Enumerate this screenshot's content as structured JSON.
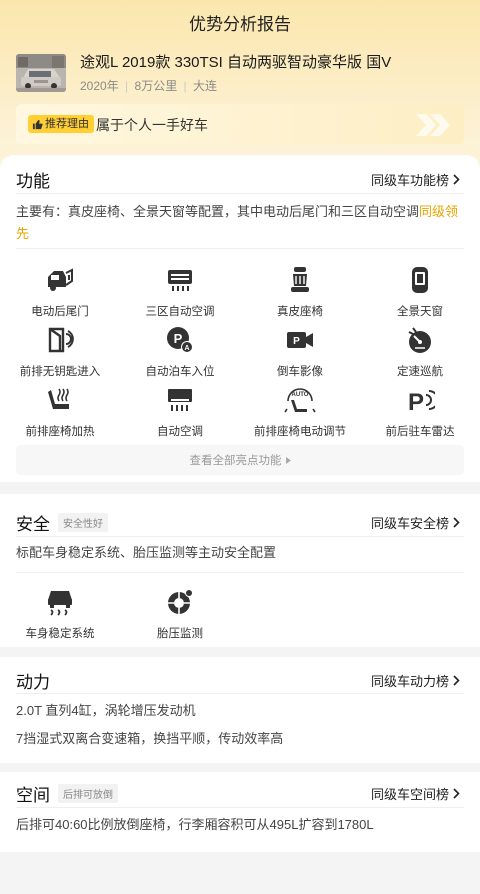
{
  "page": {
    "title": "优势分析报告"
  },
  "car": {
    "name": "途观L 2019款 330TSI 自动两驱智动豪华版 国V",
    "year": "2020年",
    "mileage": "8万公里",
    "city": "大连",
    "sep": "|"
  },
  "reason": {
    "tag": "推荐理由",
    "text": "属于个人一手好车"
  },
  "function": {
    "title": "功能",
    "rank_label": "同级车功能榜",
    "desc_prefix": "主要有：真皮座椅、全景天窗等配置，其中电动后尾门和三区自动空调",
    "desc_highlight": "同级领先",
    "features": [
      {
        "label": "电动后尾门",
        "icon": "tailgate-icon"
      },
      {
        "label": "三区自动空调",
        "icon": "climate-icon"
      },
      {
        "label": "真皮座椅",
        "icon": "leather-seat-icon"
      },
      {
        "label": "全景天窗",
        "icon": "sunroof-icon"
      },
      {
        "label": "前排无钥匙进入",
        "icon": "keyless-entry-icon"
      },
      {
        "label": "自动泊车入位",
        "icon": "auto-parking-icon"
      },
      {
        "label": "倒车影像",
        "icon": "reverse-camera-icon"
      },
      {
        "label": "定速巡航",
        "icon": "cruise-control-icon"
      },
      {
        "label": "前排座椅加热",
        "icon": "seat-heating-icon"
      },
      {
        "label": "自动空调",
        "icon": "auto-ac-icon"
      },
      {
        "label": "前排座椅电动调节",
        "icon": "power-seat-icon"
      },
      {
        "label": "前后驻车雷达",
        "icon": "parking-radar-icon"
      }
    ],
    "more_label": "查看全部亮点功能"
  },
  "safety": {
    "title": "安全",
    "tag": "安全性好",
    "rank_label": "同级车安全榜",
    "desc": "标配车身稳定系统、胎压监测等主动安全配置",
    "features": [
      {
        "label": "车身稳定系统",
        "icon": "stability-control-icon"
      },
      {
        "label": "胎压监测",
        "icon": "tire-pressure-icon"
      }
    ]
  },
  "power": {
    "title": "动力",
    "rank_label": "同级车动力榜",
    "line1": "2.0T 直列4缸，涡轮增压发动机",
    "line2": "7挡湿式双离合变速箱，换挡平顺，传动效率高"
  },
  "space": {
    "title": "空间",
    "tag": "后排可放倒",
    "rank_label": "同级车空间榜",
    "desc": "后排可40:60比例放倒座椅，行李厢容积可从495L扩容到1780L"
  },
  "colors": {
    "accent": "#e8a400",
    "tag_bg": "#ffcf33",
    "header_bg": "#fbe6ad"
  }
}
